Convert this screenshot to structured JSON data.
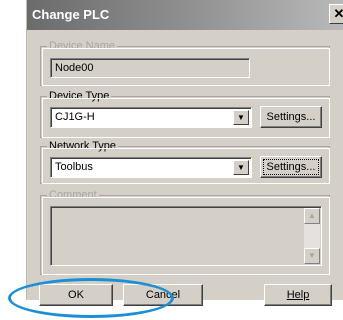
{
  "window": {
    "title": "Change PLC",
    "close_glyph": "✕"
  },
  "device_name": {
    "legend": "Device Name",
    "value": "Node00"
  },
  "device_type": {
    "legend": "Device Type",
    "selected": "CJ1G-H",
    "settings_label": "Settings..."
  },
  "network_type": {
    "legend": "Network Type",
    "selected": "Toolbus",
    "settings_label": "Settings..."
  },
  "comment": {
    "legend": "Comment",
    "value": ""
  },
  "buttons": {
    "ok": "OK",
    "cancel": "Cancel",
    "help": "Help"
  },
  "colors": {
    "highlight": "#1b8fd6",
    "dialog_face": "#d4d0c8"
  },
  "icons": [
    "close-icon",
    "dropdown-arrow-icon",
    "scroll-up-icon",
    "scroll-down-icon"
  ]
}
